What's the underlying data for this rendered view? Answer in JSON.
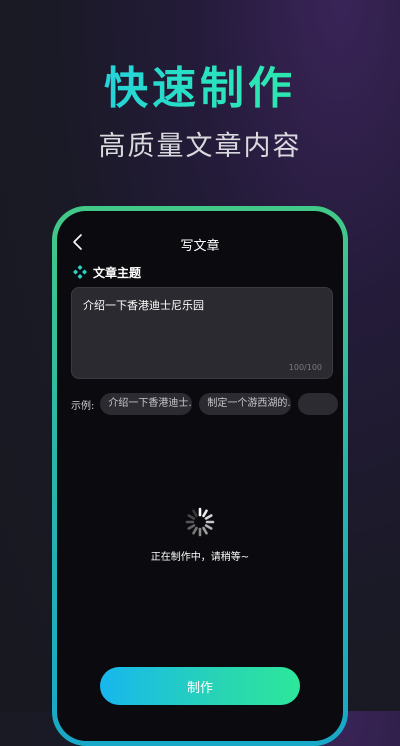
{
  "hero": {
    "title": "快速制作",
    "subtitle": "高质量文章内容"
  },
  "colors": {
    "accent_start": "#17b7ee",
    "accent_end": "#2ee79a",
    "frame": "#2fc58f",
    "screen_bg": "#0b0b0f",
    "input_bg": "#2a2a30"
  },
  "app": {
    "nav_title": "写文章",
    "back_icon": "chevron-left-icon",
    "section_icon": "diamond-cluster-icon",
    "section_label": "文章主题",
    "topic_value": "介绍一下香港迪士尼乐园",
    "char_count": "100/100",
    "examples_label": "示例:",
    "examples": [
      "介绍一下香港迪士...",
      "制定一个游西湖的...",
      ""
    ],
    "loading_icon": "spinner-icon",
    "loading_text": "正在制作中，请稍等~"
  },
  "action": {
    "make_label": "制作"
  }
}
